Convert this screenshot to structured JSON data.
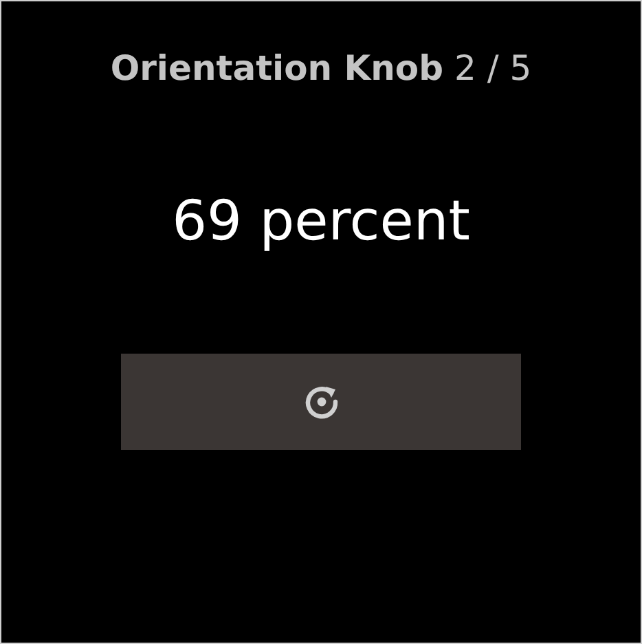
{
  "header": {
    "title": "Orientation Knob",
    "position": "2 / 5"
  },
  "value": "69 percent",
  "button": {
    "kind": "reset"
  }
}
